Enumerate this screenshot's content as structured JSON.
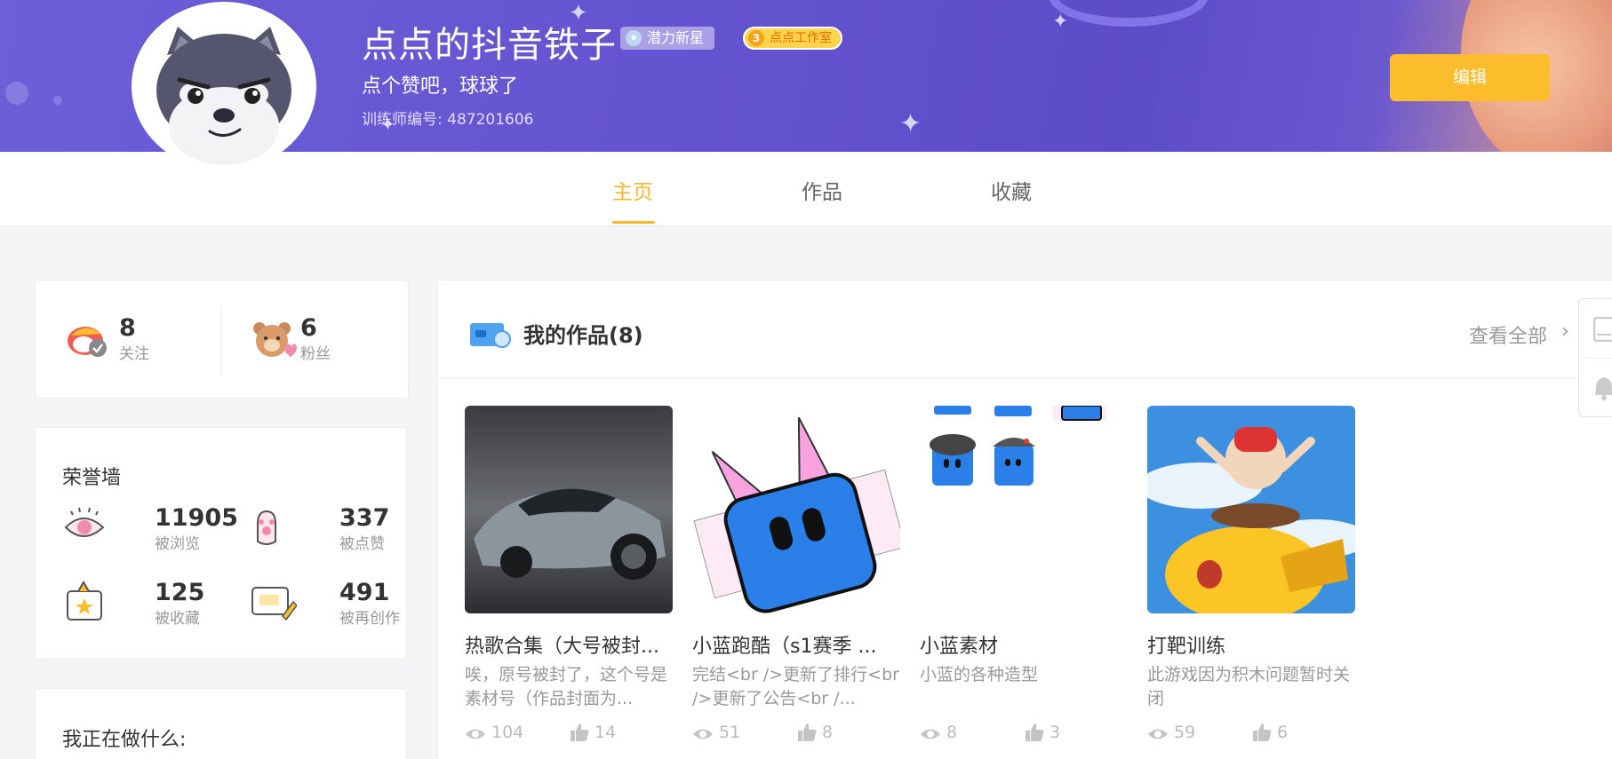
{
  "profile": {
    "name": "点点的抖音铁子",
    "badge_star": "潜力新星",
    "badge_studio_num": "3",
    "badge_studio": "点点工作室",
    "bio": "点个赞吧，球球了",
    "trainer_id": "训练师编号: 487201606",
    "edit_label": "编辑"
  },
  "tabs": [
    "主页",
    "作品",
    "收藏"
  ],
  "active_tab": "主页",
  "follow": {
    "following_count": "8",
    "following_label": "关注",
    "fans_count": "6",
    "fans_label": "粉丝"
  },
  "honor": {
    "title": "荣誉墙",
    "views": "11905",
    "views_label": "被浏览",
    "likes": "337",
    "likes_label": "被点赞",
    "favorites": "125",
    "favorites_label": "被收藏",
    "remixes": "491",
    "remixes_label": "被再创作"
  },
  "doing": {
    "title": "我正在做什么:"
  },
  "works": {
    "title": "我的作品(8)",
    "see_all": "查看全部",
    "items": [
      {
        "title": "热歌合集（大号被封...",
        "desc": "唉，原号被封了，这个号是素材号（作品封面为...",
        "views": "104",
        "likes": "14"
      },
      {
        "title": "小蓝跑酷（s1赛季 ...",
        "desc": "完结<br />更新了排行<br />更新了公告<br /...",
        "views": "51",
        "likes": "8"
      },
      {
        "title": "小蓝素材",
        "desc": "小蓝的各种造型",
        "views": "8",
        "likes": "3"
      },
      {
        "title": "打靶训练",
        "desc": "此游戏因为积木问题暂时关闭",
        "views": "59",
        "likes": "6"
      }
    ]
  },
  "colors": {
    "accent": "#fbb62a",
    "banner": "#6554d0",
    "edit_button": "#fcbd2d"
  },
  "icons": [
    "eye-icon",
    "thumbs-up-icon",
    "chevron-right-icon",
    "tablet-icon",
    "bell-icon"
  ]
}
